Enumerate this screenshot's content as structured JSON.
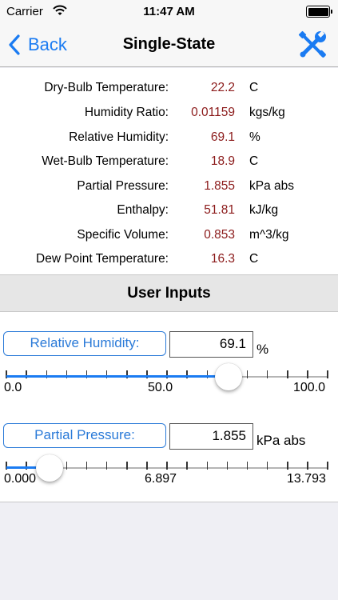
{
  "status_bar": {
    "carrier": "Carrier",
    "time": "11:47 AM"
  },
  "nav": {
    "back_label": "Back",
    "title": "Single-State",
    "tools_icon": "wrench-screwdriver-icon"
  },
  "results": [
    {
      "label": "Dry-Bulb Temperature:",
      "value": "22.2",
      "unit": "C"
    },
    {
      "label": "Humidity Ratio:",
      "value": "0.01159",
      "unit": "kgs/kg"
    },
    {
      "label": "Relative Humidity:",
      "value": "69.1",
      "unit": "%"
    },
    {
      "label": "Wet-Bulb Temperature:",
      "value": "18.9",
      "unit": "C"
    },
    {
      "label": "Partial Pressure:",
      "value": "1.855",
      "unit": "kPa abs"
    },
    {
      "label": "Enthalpy:",
      "value": "51.81",
      "unit": "kJ/kg"
    },
    {
      "label": "Specific Volume:",
      "value": "0.853",
      "unit": "m^3/kg"
    },
    {
      "label": "Dew Point Temperature:",
      "value": "16.3",
      "unit": "C"
    }
  ],
  "user_inputs": {
    "header": "User Inputs",
    "relative_humidity": {
      "button_label": "Relative Humidity:",
      "value": "69.1",
      "unit": "%",
      "slider_level": 0.691,
      "scale": {
        "min": "0.0",
        "mid": "50.0",
        "max": "100.0"
      }
    },
    "partial_pressure": {
      "button_label": "Partial Pressure:",
      "value": "1.855",
      "unit": "kPa abs",
      "slider_level": 0.1345,
      "scale": {
        "min": "0.000",
        "mid": "6.897",
        "max": "13.793"
      }
    }
  },
  "colors": {
    "accent": "#1a7bf2",
    "value_text": "#8b1a1a",
    "section_bg": "#e6e6e6"
  }
}
